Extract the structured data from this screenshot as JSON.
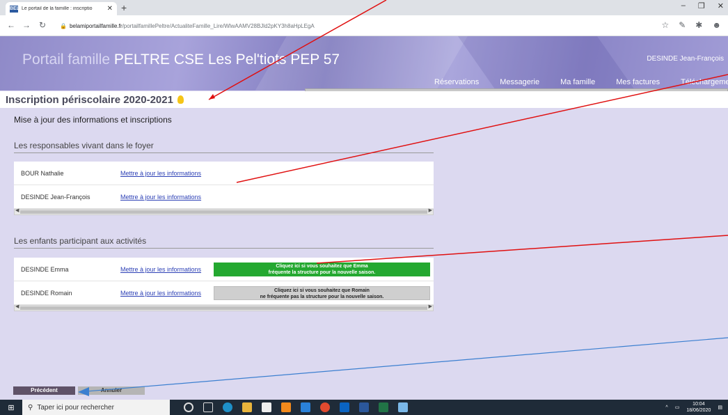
{
  "browser": {
    "tab_title": "Le portail de la famille : inscriptio",
    "favicon_text": "BEL",
    "url_host": "belamiportailfamille.fr",
    "url_path": "/portailfamillePeltre/ActualiteFamille_Lire/WlwAAMV28BJld2pKY3h8aHpLEgA"
  },
  "header": {
    "portal_label": "Portail famille",
    "org_name": "PELTRE CSE Les Pel'tiots PEP 57",
    "user_name": "DESINDE Jean-François",
    "nav": [
      "Réservations",
      "Messagerie",
      "Ma famille",
      "Mes factures",
      "Téléchargements"
    ]
  },
  "page": {
    "title": "Inscription périscolaire 2020-2021",
    "subtitle": "Mise à jour des informations et inscriptions"
  },
  "responsables": {
    "heading": "Les responsables vivant dans le foyer",
    "rows": [
      {
        "name": "BOUR Nathalie",
        "link": "Mettre à jour les informations"
      },
      {
        "name": "DESINDE Jean-François",
        "link": "Mettre à jour les informations"
      }
    ]
  },
  "enfants": {
    "heading": "Les enfants participant aux activités",
    "rows": [
      {
        "name": "DESINDE Emma",
        "link": "Mettre à jour les informations",
        "action_line1": "Cliquez ici si vous souhaitez que Emma",
        "action_line2": "fréquente la structure pour la nouvelle saison.",
        "action_color": "#24a830"
      },
      {
        "name": "DESINDE Romain",
        "link": "Mettre à jour les informations",
        "action_line1": "Cliquez ici si vous souhaitez que Romain",
        "action_line2": "ne fréquente pas la structure pour la nouvelle saison.",
        "action_color": "#cfcfcf"
      }
    ]
  },
  "buttons": {
    "previous": "Précédent",
    "cancel": "Annuler"
  },
  "taskbar": {
    "search_placeholder": "Taper ici pour rechercher",
    "time": "10:04",
    "date": "18/06/2020"
  },
  "colors": {
    "header_accent": "#9994d2",
    "link": "#2b3fb5",
    "annotation_red": "#e01010",
    "annotation_blue": "#3b7fd0"
  }
}
